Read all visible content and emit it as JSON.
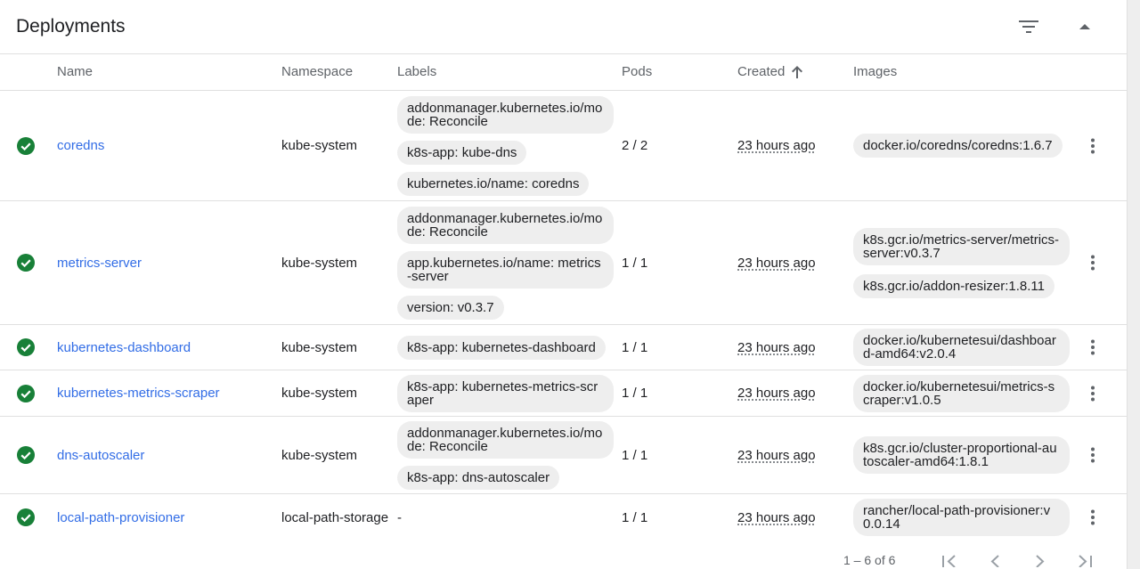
{
  "card": {
    "title": "Deployments",
    "filter_icon": "filter-list-icon",
    "collapse_icon": "expand-less-icon"
  },
  "columns": {
    "name": "Name",
    "namespace": "Namespace",
    "labels": "Labels",
    "pods": "Pods",
    "created": "Created",
    "created_sort_icon": "arrow-upward-icon",
    "images": "Images"
  },
  "rows": [
    {
      "status_icon": "check-circle-icon",
      "name": "coredns",
      "namespace": "kube-system",
      "labels": [
        "addonmanager.kubernetes.io/mode: Reconcile",
        "k8s-app: kube-dns",
        "kubernetes.io/name: coredns"
      ],
      "pods": "2 / 2",
      "created": "23 hours ago",
      "images": [
        "docker.io/coredns/coredns:1.6.7"
      ]
    },
    {
      "status_icon": "check-circle-icon",
      "name": "metrics-server",
      "namespace": "kube-system",
      "labels": [
        "addonmanager.kubernetes.io/mode: Reconcile",
        "app.kubernetes.io/name: metrics-server",
        "version: v0.3.7"
      ],
      "pods": "1 / 1",
      "created": "23 hours ago",
      "images": [
        "k8s.gcr.io/metrics-server/metrics-server:v0.3.7",
        "k8s.gcr.io/addon-resizer:1.8.11"
      ]
    },
    {
      "status_icon": "check-circle-icon",
      "name": "kubernetes-dashboard",
      "namespace": "kube-system",
      "labels": [
        "k8s-app: kubernetes-dashboard"
      ],
      "pods": "1 / 1",
      "created": "23 hours ago",
      "images": [
        "docker.io/kubernetesui/dashboard-amd64:v2.0.4"
      ]
    },
    {
      "status_icon": "check-circle-icon",
      "name": "kubernetes-metrics-scraper",
      "namespace": "kube-system",
      "labels": [
        "k8s-app: kubernetes-metrics-scraper"
      ],
      "pods": "1 / 1",
      "created": "23 hours ago",
      "images": [
        "docker.io/kubernetesui/metrics-scraper:v1.0.5"
      ]
    },
    {
      "status_icon": "check-circle-icon",
      "name": "dns-autoscaler",
      "namespace": "kube-system",
      "labels": [
        "addonmanager.kubernetes.io/mode: Reconcile",
        "k8s-app: dns-autoscaler"
      ],
      "pods": "1 / 1",
      "created": "23 hours ago",
      "images": [
        "k8s.gcr.io/cluster-proportional-autoscaler-amd64:1.8.1"
      ]
    },
    {
      "status_icon": "check-circle-icon",
      "name": "local-path-provisioner",
      "namespace": "local-path-storage",
      "labels": [],
      "labels_empty": "-",
      "pods": "1 / 1",
      "created": "23 hours ago",
      "images": [
        "rancher/local-path-provisioner:v0.0.14"
      ]
    }
  ],
  "paginator": {
    "range_label": "1 – 6 of 6",
    "first_icon": "first-page-icon",
    "prev_icon": "chevron-left-icon",
    "next_icon": "chevron-right-icon",
    "last_icon": "last-page-icon"
  },
  "colors": {
    "link": "#326de6",
    "success": "#188038",
    "chip_bg": "#eeeeee",
    "divider": "#e0e0e0"
  }
}
